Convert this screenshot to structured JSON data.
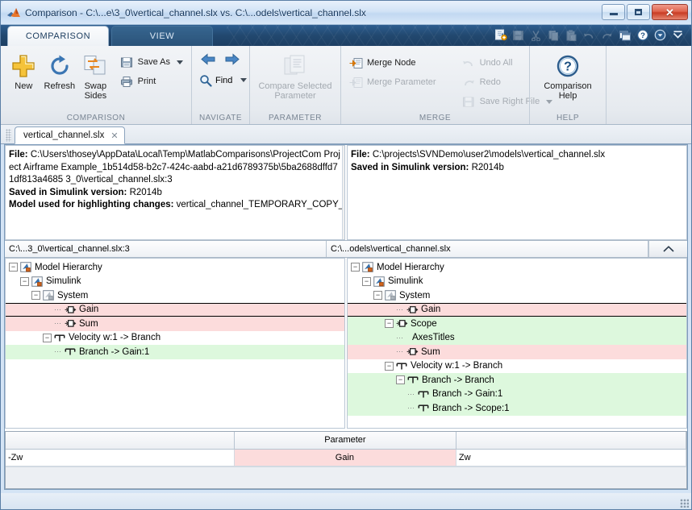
{
  "window": {
    "title": "Comparison - C:\\...e\\3_0\\vertical_channel.slx vs. C:\\...odels\\vertical_channel.slx",
    "app_icon": "matlab-icon",
    "minimize_label": "",
    "maximize_label": "",
    "close_label": "✕"
  },
  "ribbon": {
    "tabs": [
      {
        "label": "COMPARISON",
        "active": true
      },
      {
        "label": "VIEW",
        "active": false
      }
    ],
    "quick_access": [
      {
        "icon": "new-comparison-icon",
        "enabled": true
      },
      {
        "icon": "save-icon",
        "enabled": false
      },
      {
        "icon": "cut-icon",
        "enabled": false
      },
      {
        "icon": "copy-icon",
        "enabled": false
      },
      {
        "icon": "paste-icon",
        "enabled": false
      },
      {
        "icon": "undo-icon",
        "enabled": false
      },
      {
        "icon": "redo-icon",
        "enabled": false
      },
      {
        "icon": "window-layout-icon",
        "enabled": true
      },
      {
        "icon": "help-icon",
        "enabled": true
      },
      {
        "icon": "customize-dropdown-icon",
        "enabled": true
      },
      {
        "icon": "minimize-ribbon-icon",
        "enabled": true
      }
    ],
    "groups": [
      {
        "name": "comparison",
        "label": "COMPARISON",
        "big_buttons": [
          {
            "label": "New",
            "icon": "plus-icon",
            "enabled": true
          },
          {
            "label": "Refresh",
            "icon": "refresh-icon",
            "enabled": true
          },
          {
            "label": "Swap\nSides",
            "label_line1": "Swap",
            "label_line2": "Sides",
            "icon": "swap-sides-icon",
            "enabled": true
          }
        ],
        "small_buttons": [
          {
            "label": "Save As",
            "icon": "save-as-icon",
            "has_dropdown": true,
            "enabled": true
          },
          {
            "label": "Print",
            "icon": "print-icon",
            "has_dropdown": false,
            "enabled": true
          }
        ]
      },
      {
        "name": "navigate",
        "label": "NAVIGATE",
        "arrows": [
          {
            "icon": "arrow-left-icon",
            "enabled": true
          },
          {
            "icon": "arrow-right-icon",
            "enabled": true
          }
        ],
        "find": {
          "label": "Find",
          "icon": "search-icon",
          "has_dropdown": true,
          "enabled": true
        }
      },
      {
        "name": "parameter",
        "label": "PARAMETER",
        "big_buttons": [
          {
            "label_line1": "Compare Selected",
            "label_line2": "Parameter",
            "icon": "compare-parameter-icon",
            "enabled": false
          }
        ]
      },
      {
        "name": "merge",
        "label": "MERGE",
        "small_buttons": [
          {
            "label": "Merge Node",
            "icon": "merge-node-icon",
            "has_dropdown": false,
            "enabled": true
          },
          {
            "label": "Merge Parameter",
            "icon": "merge-parameter-icon",
            "has_dropdown": false,
            "enabled": false
          }
        ],
        "small_buttons_right": [
          {
            "label": "Undo All",
            "icon": "undo-icon",
            "has_dropdown": false,
            "enabled": false
          },
          {
            "label": "Redo",
            "icon": "redo-icon",
            "has_dropdown": false,
            "enabled": false
          },
          {
            "label": "Save Right File",
            "icon": "save-icon",
            "has_dropdown": true,
            "enabled": false
          }
        ]
      },
      {
        "name": "help",
        "label": "HELP",
        "big_buttons": [
          {
            "label_line1": "Comparison",
            "label_line2": "Help",
            "icon": "help-icon",
            "enabled": true
          }
        ]
      }
    ]
  },
  "document_tab": {
    "label": "vertical_channel.slx",
    "close_glyph": "✕"
  },
  "left_pane": {
    "info": {
      "file_label": "File:",
      "file_value": "C:\\Users\\thosey\\AppData\\Local\\Temp\\MatlabComparisons\\ProjectCom Project Airframe Example_1b514d58-b2c7-424c-aabd-a21d6789375b\\5ba2688dffd71df813a4685 3_0\\vertical_channel.slx:3",
      "version_label": "Saved in Simulink version:",
      "version_value": "R2014b",
      "highlight_label": "Model used for highlighting changes:",
      "highlight_value": "vertical_channel_TEMPORARY_COPY_"
    },
    "path": "C:\\...3_0\\vertical_channel.slx:3",
    "tree": [
      {
        "label": "Model Hierarchy",
        "depth": 0,
        "expander": "minus",
        "icon": "model-hierarchy-icon",
        "status": "none",
        "selected": false
      },
      {
        "label": "Simulink",
        "depth": 1,
        "expander": "minus",
        "icon": "model-hierarchy-icon",
        "status": "none",
        "selected": false
      },
      {
        "label": "System",
        "depth": 2,
        "expander": "minus",
        "icon": "system-icon",
        "status": "none",
        "selected": false
      },
      {
        "label": "Gain",
        "depth": 4,
        "expander": "none",
        "icon": "block-icon",
        "status": "pink",
        "selected": true
      },
      {
        "label": "Sum",
        "depth": 4,
        "expander": "none",
        "icon": "block-icon",
        "status": "pink",
        "selected": false
      },
      {
        "label": "Velocity w:1 -> Branch",
        "depth": 3,
        "expander": "minus",
        "icon": "branch-icon",
        "status": "none",
        "selected": false
      },
      {
        "label": "Branch -> Gain:1",
        "depth": 4,
        "expander": "none",
        "icon": "branch-icon",
        "status": "green",
        "selected": false
      }
    ]
  },
  "right_pane": {
    "info": {
      "file_label": "File:",
      "file_value": "C:\\projects\\SVNDemo\\user2\\models\\vertical_channel.slx",
      "version_label": "Saved in Simulink version:",
      "version_value": "R2014b"
    },
    "path": "C:\\...odels\\vertical_channel.slx",
    "collapse_glyph": "⌃",
    "tree": [
      {
        "label": "Model Hierarchy",
        "depth": 0,
        "expander": "minus",
        "icon": "model-hierarchy-icon",
        "status": "none",
        "selected": false
      },
      {
        "label": "Simulink",
        "depth": 1,
        "expander": "minus",
        "icon": "model-hierarchy-icon",
        "status": "none",
        "selected": false
      },
      {
        "label": "System",
        "depth": 2,
        "expander": "minus",
        "icon": "system-icon",
        "status": "none",
        "selected": false
      },
      {
        "label": "Gain",
        "depth": 4,
        "expander": "none",
        "icon": "block-icon",
        "status": "pink",
        "selected": true
      },
      {
        "label": "Scope",
        "depth": 3,
        "expander": "minus",
        "icon": "block-icon",
        "status": "green",
        "selected": false
      },
      {
        "label": "AxesTitles",
        "depth": 4,
        "expander": "none",
        "icon": "none",
        "status": "green",
        "selected": false
      },
      {
        "label": "Sum",
        "depth": 4,
        "expander": "none",
        "icon": "block-icon",
        "status": "pink",
        "selected": false
      },
      {
        "label": "Velocity w:1 -> Branch",
        "depth": 3,
        "expander": "minus",
        "icon": "branch-icon",
        "status": "none",
        "selected": false
      },
      {
        "label": "Branch -> Branch",
        "depth": 4,
        "expander": "minus",
        "icon": "branch-icon",
        "status": "green",
        "selected": false
      },
      {
        "label": "Branch -> Gain:1",
        "depth": 5,
        "expander": "none",
        "icon": "branch-icon",
        "status": "green",
        "selected": false
      },
      {
        "label": "Branch -> Scope:1",
        "depth": 5,
        "expander": "none",
        "icon": "branch-icon",
        "status": "green",
        "selected": false
      }
    ]
  },
  "parameter_table": {
    "headers": [
      "",
      "Parameter",
      ""
    ],
    "rows": [
      {
        "left": "-Zw",
        "parameter": "Gain",
        "right": "Zw",
        "status": "pink"
      }
    ]
  },
  "colors": {
    "changed_pink": "#fcdcdc",
    "added_green": "#ddf8dd",
    "window_chrome": "#d4e4f5",
    "ribbon_tabstrip": "#22486f",
    "accent_orange": "#f0a000"
  }
}
